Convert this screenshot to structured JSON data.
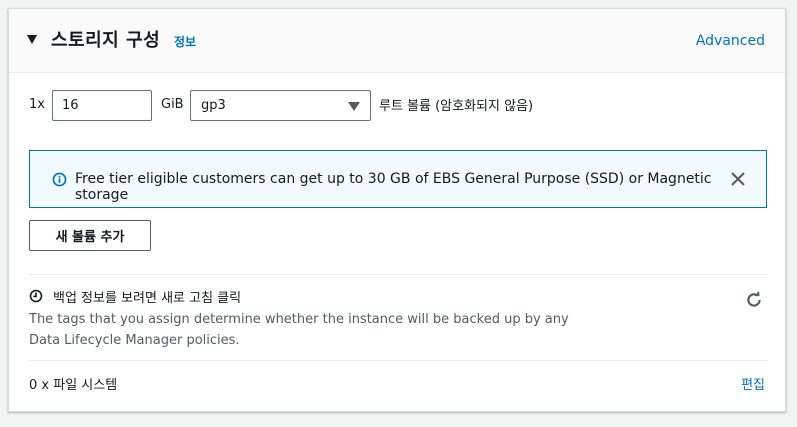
{
  "section": {
    "title": "스토리지 구성",
    "info_link": "정보",
    "advanced_link": "Advanced"
  },
  "volume": {
    "quantity_label": "1x",
    "size_value": "16",
    "size_unit": "GiB",
    "type_value": "gp3",
    "root_label": "루트 볼륨  (암호화되지 않음)"
  },
  "alert": {
    "message": "Free tier eligible customers can get up to 30 GB of EBS General Purpose (SSD) or Magnetic storage"
  },
  "add_volume_button": "새 볼륨 추가",
  "backup": {
    "title": "백업 정보를 보려면 새로 고침 클릭",
    "description": "The tags that you assign determine whether the instance will be backed up by any Data Lifecycle Manager policies."
  },
  "filesystems": {
    "label": "0 x 파일 시스템",
    "edit_link": "편집"
  },
  "colors": {
    "link": "#0073bb",
    "alert_border": "#0073bb",
    "alert_bg": "#f1faff"
  }
}
